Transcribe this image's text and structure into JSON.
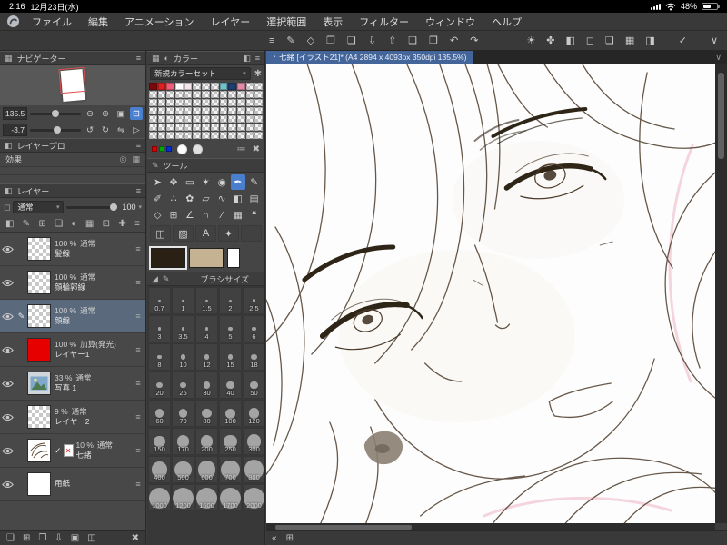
{
  "status_bar": {
    "time": "2:16",
    "date": "12月23日(水)",
    "battery_percent": "48%"
  },
  "menu_bar": {
    "items": [
      "ファイル",
      "編集",
      "アニメーション",
      "レイヤー",
      "選択範囲",
      "表示",
      "フィルター",
      "ウィンドウ",
      "ヘルプ"
    ]
  },
  "toolbar": {
    "left_icons": [
      {
        "name": "main-menu-icon",
        "glyph": "≡"
      },
      {
        "name": "pen-settings-icon",
        "glyph": "✎"
      },
      {
        "name": "figure-settings-icon",
        "glyph": "◇"
      },
      {
        "name": "clipboard-icon",
        "glyph": "❐"
      },
      {
        "name": "folder-icon",
        "glyph": "❏"
      },
      {
        "name": "save-icon",
        "glyph": "⇩"
      },
      {
        "name": "export-icon",
        "glyph": "⇧"
      },
      {
        "name": "clipboard-copy-icon",
        "glyph": "❑"
      },
      {
        "name": "clipboard-paste-icon",
        "glyph": "❒"
      },
      {
        "name": "undo-icon",
        "glyph": "↶"
      },
      {
        "name": "redo-icon",
        "glyph": "↷"
      }
    ],
    "right_icons": [
      {
        "name": "sun-icon",
        "glyph": "☀"
      },
      {
        "name": "droplet-icon",
        "glyph": "✤"
      },
      {
        "name": "bucket-icon",
        "glyph": "◧"
      },
      {
        "name": "marquee-icon",
        "glyph": "◻"
      },
      {
        "name": "layers-icon",
        "glyph": "❏"
      },
      {
        "name": "grid-icon",
        "glyph": "▦"
      },
      {
        "name": "panel-layout-icon",
        "glyph": "◨"
      },
      {
        "name": "confirm-icon",
        "glyph": "✓"
      },
      {
        "name": "chevron-down-icon",
        "glyph": "∨"
      }
    ]
  },
  "document_tab": {
    "title": "七緒 [イラスト21]* (A4 2894 x 4093px 350dpi 135.5%)"
  },
  "navigator": {
    "title": "ナビゲーター",
    "zoom_value": "135.5",
    "rotate_value": "-3.7"
  },
  "layer_property": {
    "title": "レイヤープロ",
    "effect_label": "効果"
  },
  "layer_panel": {
    "title": "レイヤー",
    "blend_mode": "通常",
    "opacity_value": "100",
    "option_icons": [
      {
        "name": "clipping-icon",
        "glyph": "◧"
      },
      {
        "name": "edit-layer-icon",
        "glyph": "✎"
      },
      {
        "name": "add-mask-icon",
        "glyph": "⊞"
      },
      {
        "name": "folder-icon",
        "glyph": "❏"
      },
      {
        "name": "tone-icon",
        "glyph": "◐"
      },
      {
        "name": "grid-icon",
        "glyph": "▦"
      },
      {
        "name": "lock-icon",
        "glyph": "⊡"
      },
      {
        "name": "add-icon",
        "glyph": "✚"
      },
      {
        "name": "menu-icon",
        "glyph": "≡"
      }
    ],
    "layers": [
      {
        "opacity": "100 %",
        "mode": "通常",
        "name": "髪線",
        "thumb": "checker"
      },
      {
        "opacity": "100 %",
        "mode": "通常",
        "name": "顔輪郭線",
        "thumb": "checker"
      },
      {
        "opacity": "100 %",
        "mode": "通常",
        "name": "顔線",
        "thumb": "checker",
        "selected": true
      },
      {
        "opacity": "100 %",
        "mode": "加算(発光)",
        "name": "レイヤー1",
        "thumb": "red"
      },
      {
        "opacity": "33 %",
        "mode": "通常",
        "name": "写真 1",
        "thumb": "photo"
      },
      {
        "opacity": "9 %",
        "mode": "通常",
        "name": "レイヤー2",
        "thumb": "checker"
      },
      {
        "opacity": "10 %",
        "mode": "通常",
        "name": "七緒",
        "thumb": "artwork",
        "checked": true,
        "mask_disabled": true
      },
      {
        "opacity": "",
        "mode": "",
        "name": "用紙",
        "thumb": "white"
      }
    ],
    "footer_icons": [
      {
        "name": "new-folder-icon",
        "glyph": "❏"
      },
      {
        "name": "new-layer-icon",
        "glyph": "⊞"
      },
      {
        "name": "duplicate-layer-icon",
        "glyph": "❐"
      },
      {
        "name": "merge-down-icon",
        "glyph": "⇩"
      },
      {
        "name": "layer-view-icon",
        "glyph": "▣"
      },
      {
        "name": "screenshot-icon",
        "glyph": "◫"
      },
      {
        "name": "delete-layer-icon",
        "glyph": "✖"
      }
    ]
  },
  "color_panel": {
    "tab_label": "カラー",
    "color_set_name": "新規カラーセット",
    "palette": [
      "#7c0a0a",
      "#dd2020",
      "#ef5e76",
      "#ffffff",
      "#f6e7ec",
      "checker",
      "checker",
      "checker",
      "#74c2ca",
      "#1e3e70",
      "#e18ba6",
      "checker",
      "checker"
    ],
    "checker_cols": 13,
    "checker_rows": 6,
    "current_rgb": [
      "#e00000",
      "#00a800",
      "#0030d8"
    ]
  },
  "tool_panel": {
    "title": "ツール",
    "tools": [
      {
        "name": "operation-tool",
        "glyph": "➤"
      },
      {
        "name": "move-layer-tool",
        "glyph": "✥"
      },
      {
        "name": "selection-tool",
        "glyph": "▭"
      },
      {
        "name": "auto-select-tool",
        "glyph": "✶"
      },
      {
        "name": "eyedropper-tool",
        "glyph": "◉"
      },
      {
        "name": "pen-tool",
        "glyph": "✒",
        "selected": true
      },
      {
        "name": "pencil-tool",
        "glyph": "✎"
      },
      {
        "name": "brush-tool",
        "glyph": "✐"
      },
      {
        "name": "airbrush-tool",
        "glyph": "∴"
      },
      {
        "name": "decoration-tool",
        "glyph": "✿"
      },
      {
        "name": "eraser-tool",
        "glyph": "▱"
      },
      {
        "name": "blend-tool",
        "glyph": "∿"
      },
      {
        "name": "fill-tool",
        "glyph": "◧"
      },
      {
        "name": "gradient-tool",
        "glyph": "▤"
      },
      {
        "name": "figure-tool",
        "glyph": "◇"
      },
      {
        "name": "frame-border-tool",
        "glyph": "⊞"
      },
      {
        "name": "ruler-tool",
        "glyph": "∠"
      },
      {
        "name": "correct-line-tool",
        "glyph": "∩"
      },
      {
        "name": "line-tool",
        "glyph": "∕"
      },
      {
        "name": "grid-tool",
        "glyph": "▦"
      },
      {
        "name": "balloon-tool",
        "glyph": "❝"
      },
      {
        "name": "frame-tool",
        "glyph": "◫"
      },
      {
        "name": "tone-tool",
        "glyph": "▨"
      },
      {
        "name": "text-tool",
        "glyph": "A"
      },
      {
        "name": "effect-tool",
        "glyph": "✦"
      },
      {
        "name": "transparent-color",
        "glyph": "",
        "checker": true
      }
    ],
    "main_color": "#2a2013",
    "sub_color": "#c4b292"
  },
  "brush_size_panel": {
    "title": "ブラシサイズ",
    "sizes": [
      "0.7",
      "1",
      "1.5",
      "2",
      "2.5",
      "3",
      "3.5",
      "4",
      "5",
      "6",
      "8",
      "10",
      "12",
      "15",
      "18",
      "20",
      "25",
      "30",
      "40",
      "50",
      "60",
      "70",
      "80",
      "100",
      "120",
      "150",
      "170",
      "200",
      "250",
      "300",
      "400",
      "500",
      "600",
      "700",
      "800",
      "1000",
      "1200",
      "1500",
      "1700",
      "2000"
    ]
  },
  "icons": {
    "menu": "≡",
    "grid": "▦",
    "wheel": "◐",
    "swatch": "◧",
    "gear": "✱",
    "caret": "▾",
    "chevron": "∨",
    "zoom_out": "⊖",
    "zoom_in": "⊕",
    "reset": "▣",
    "fit": "⊡",
    "rotate_left": "↺",
    "rotate_right": "↻",
    "flip": "⇋",
    "play": "▷",
    "border_effect": "◎",
    "blend_square": "◻",
    "pen": "✎",
    "brush_tip": "◢",
    "sliders": "≔",
    "trash": "✖",
    "check": "✓",
    "cross": "✕",
    "tab_dot": "▪",
    "collapse": "«",
    "nav_toggle": "⊞"
  }
}
